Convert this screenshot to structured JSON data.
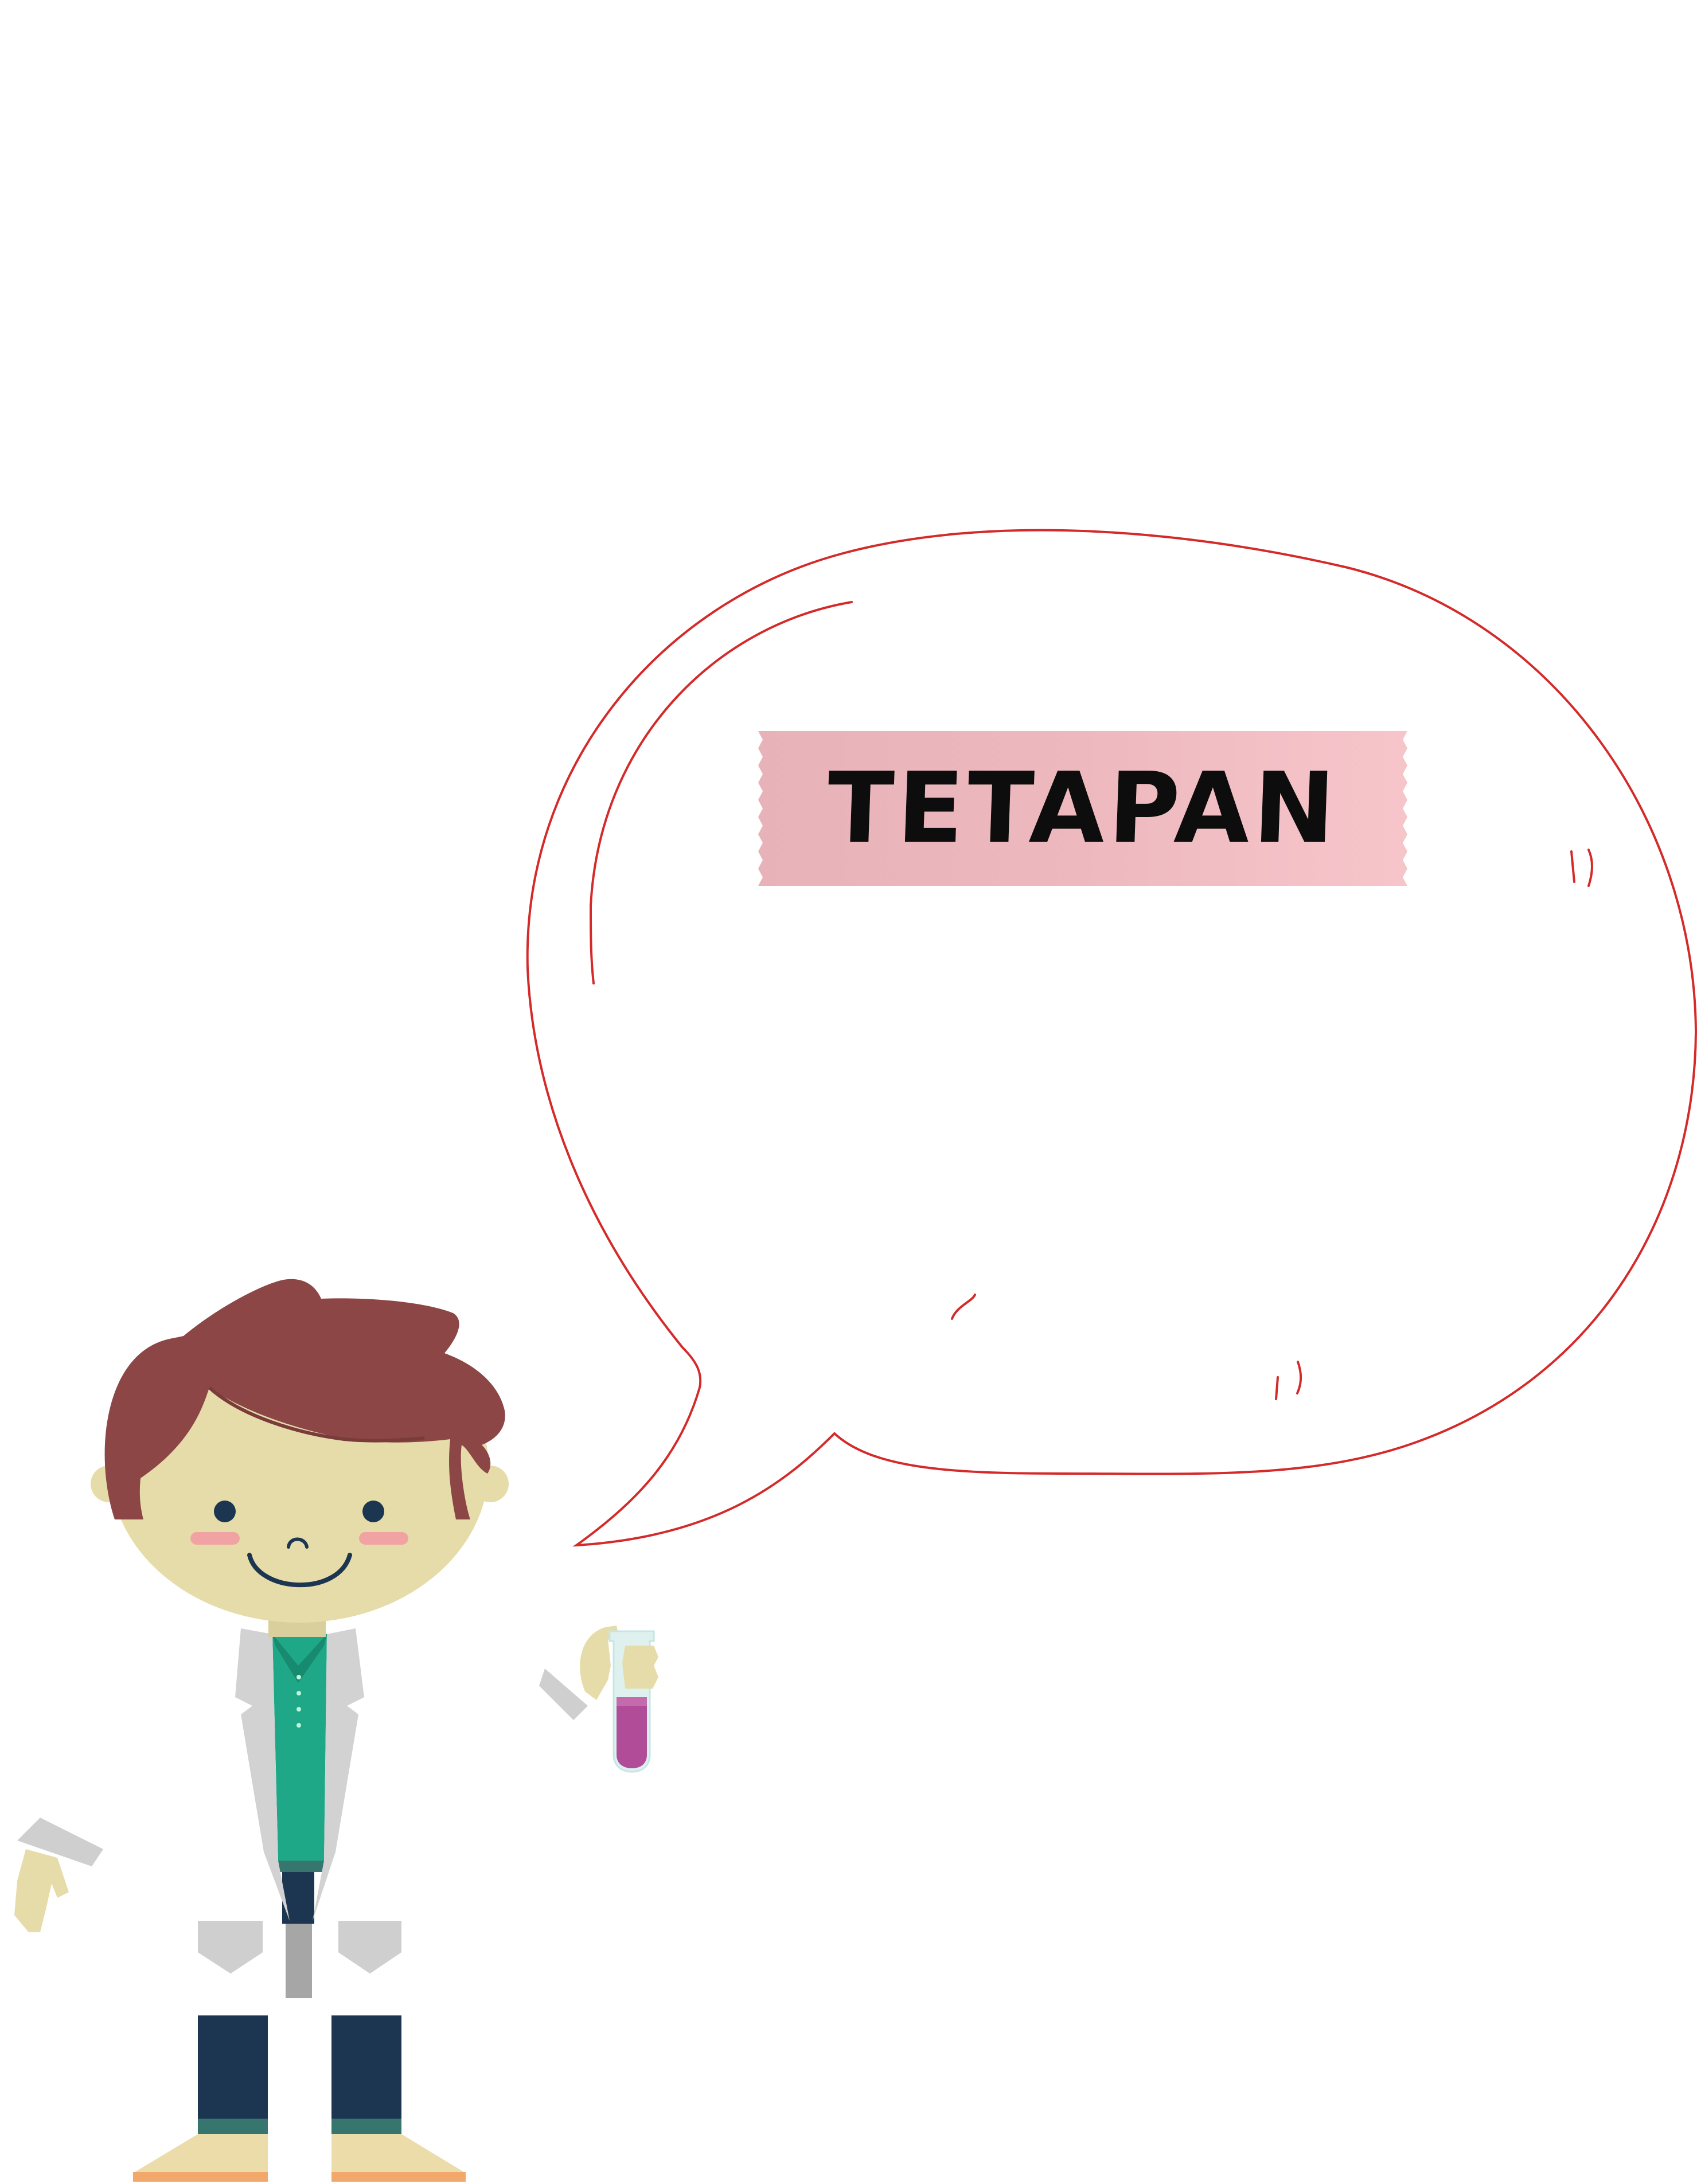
{
  "label": {
    "title": "TETAPAN"
  },
  "colors": {
    "bubble_outline": "#d42a2a",
    "tape": "#efb8be",
    "hair": "#8c4646",
    "skin": "#e6dcaa",
    "shirt": "#1fa887",
    "coat": "#d2d2d2",
    "pants": "#1c3550",
    "shoes": "#ebdcaa",
    "test_tube_liquid": "#b04c98"
  },
  "icons": {
    "character": "scientist-boy-icon",
    "tube": "test-tube-icon"
  }
}
